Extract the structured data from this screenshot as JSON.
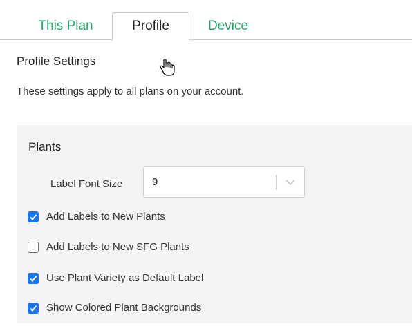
{
  "tabs": {
    "this_plan": "This Plan",
    "profile": "Profile",
    "device": "Device"
  },
  "profile": {
    "title": "Profile Settings",
    "description": "These settings apply to all plans on your account."
  },
  "plants": {
    "title": "Plants",
    "label_font_size": {
      "label": "Label Font Size",
      "value": "9"
    },
    "options": [
      {
        "label": "Add Labels to New Plants",
        "checked": true
      },
      {
        "label": "Add Labels to New SFG Plants",
        "checked": false
      },
      {
        "label": "Use Plant Variety as Default Label",
        "checked": true
      },
      {
        "label": "Show Colored Plant Backgrounds",
        "checked": true
      }
    ]
  },
  "colors": {
    "tab_link": "#2aa26a",
    "checkbox_checked": "#1a73e8",
    "panel_bg": "#f4f4f4"
  }
}
